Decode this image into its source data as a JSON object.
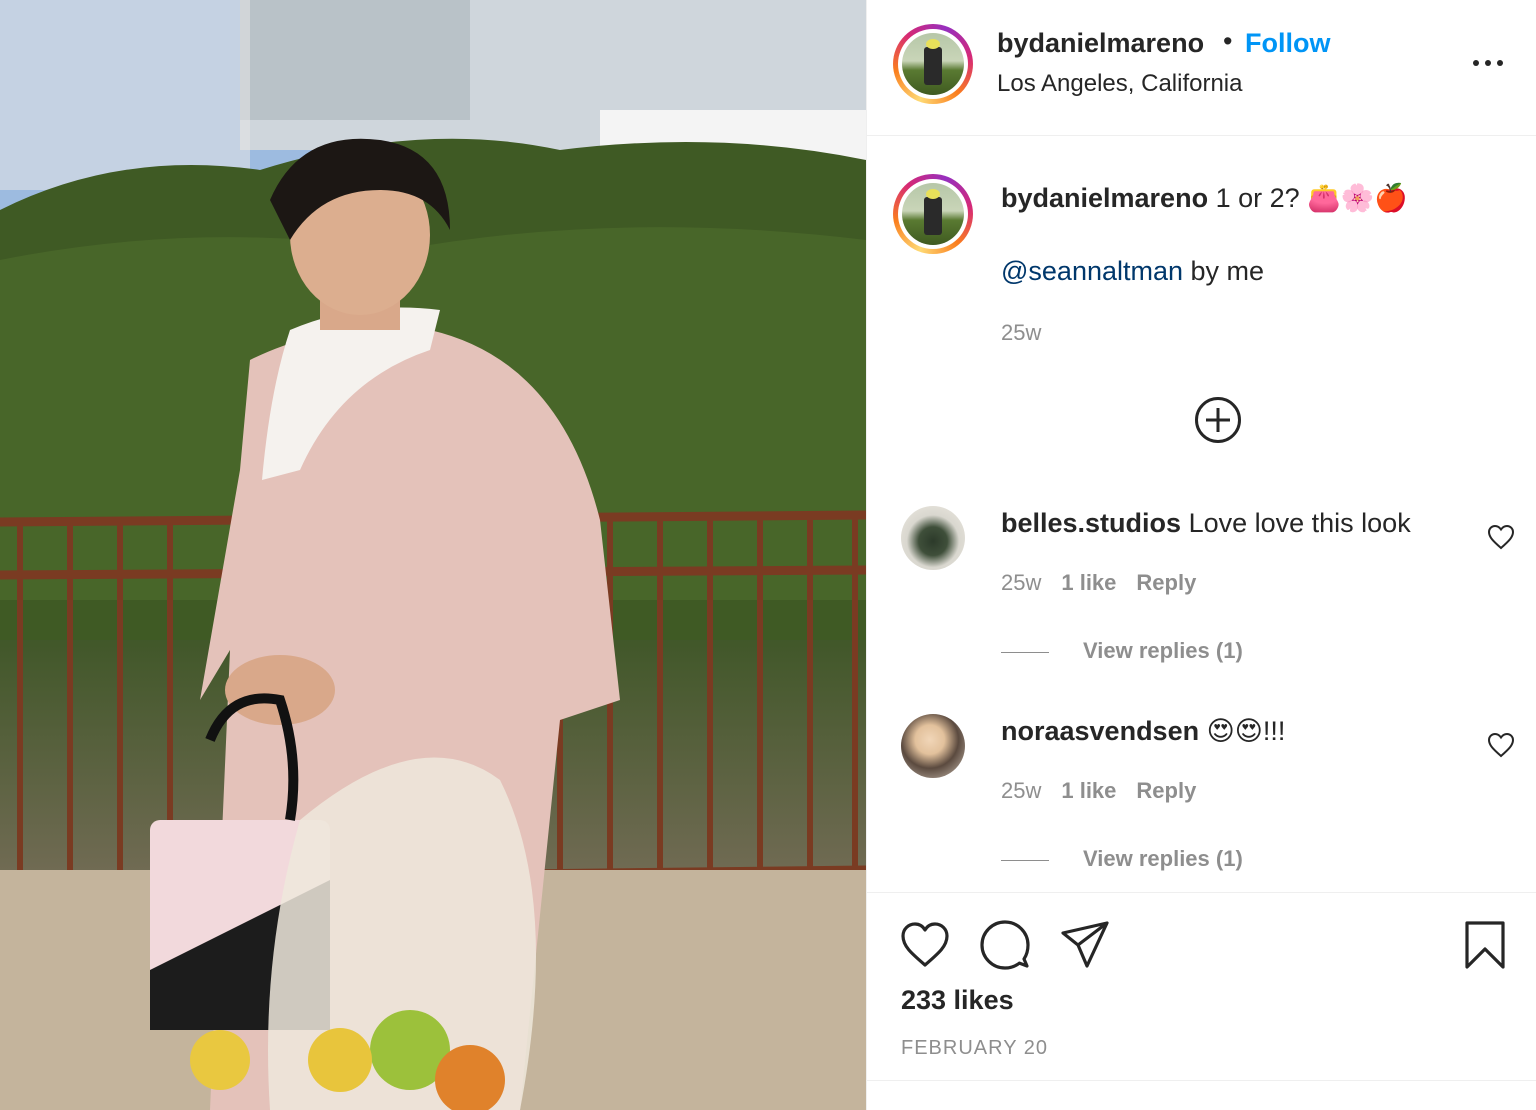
{
  "post": {
    "photo_alt_icon": "post-photo",
    "author": "bydanielmareno",
    "follow_label": "Follow",
    "separator": "•",
    "location": "Los Angeles, California",
    "more_icon": "more-options-icon"
  },
  "caption": {
    "user": "bydanielmareno",
    "text": " 1 or 2? 👛🌸🍎",
    "mention": "@seannaltman",
    "mention_suffix": " by me",
    "time": "25w"
  },
  "load_more_icon": "plus-circle-icon",
  "comments": [
    {
      "user": "belles.studios",
      "text": " Love love this look",
      "time": "25w",
      "likes": "1 like",
      "reply": "Reply",
      "view_replies": "View replies (1)"
    },
    {
      "user": "noraasvendsen",
      "text": " 😍😍!!!",
      "time": "25w",
      "likes": "1 like",
      "reply": "Reply",
      "view_replies": "View replies (1)"
    }
  ],
  "actions": {
    "icons": [
      "heart-icon",
      "comment-icon",
      "share-icon",
      "bookmark-icon"
    ],
    "likes": "233 likes",
    "date": "FEBRUARY 20"
  },
  "colors": {
    "link_blue": "#0095f6",
    "mention_blue": "#00376b",
    "muted": "#8e8e8e",
    "text": "#262626"
  }
}
